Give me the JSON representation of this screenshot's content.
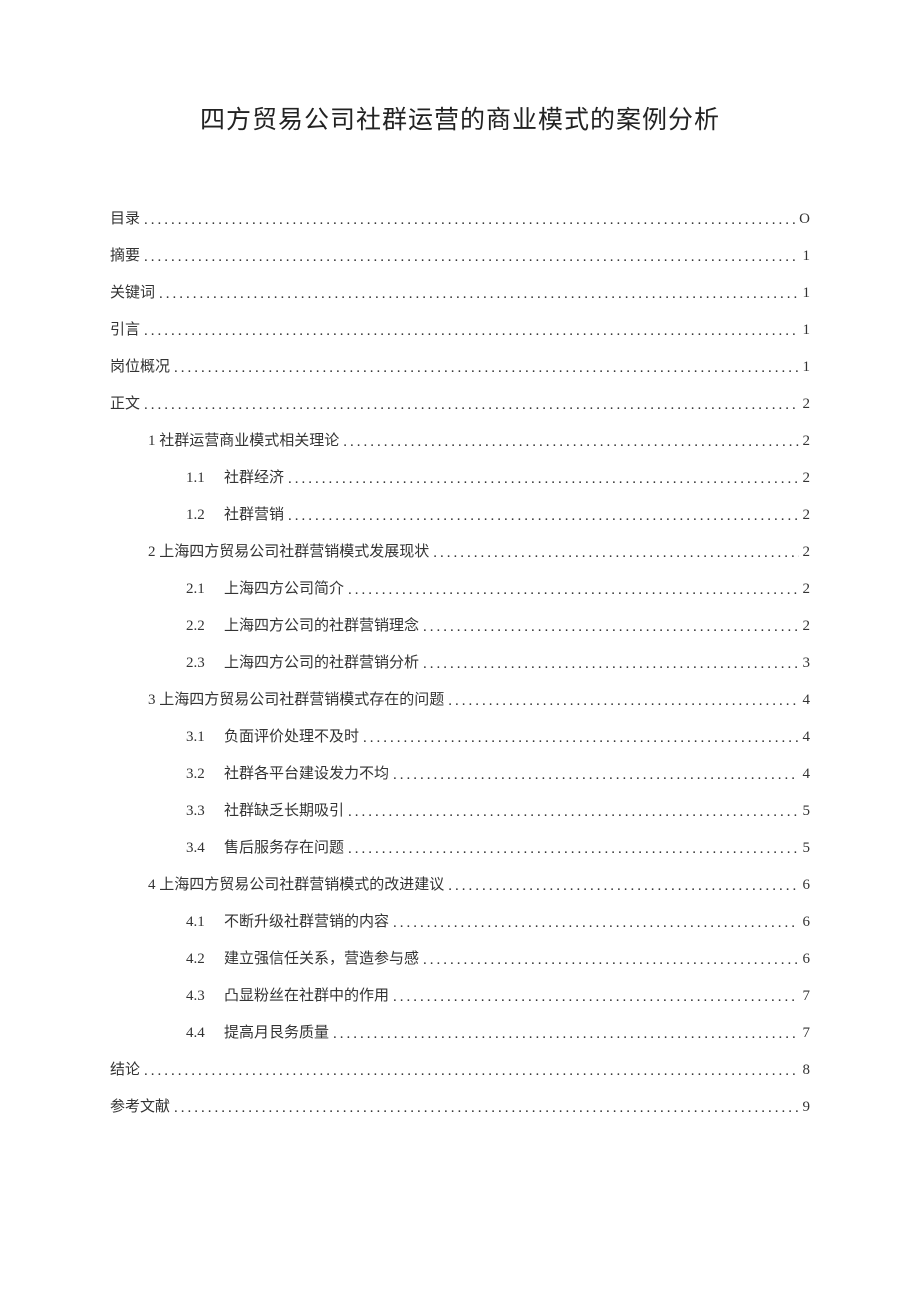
{
  "title": "四方贸易公司社群运营的商业模式的案例分析",
  "toc": [
    {
      "level": 0,
      "num": "",
      "label": "目录",
      "page": "O"
    },
    {
      "level": 0,
      "num": "",
      "label": "摘要",
      "page": "1"
    },
    {
      "level": 0,
      "num": "",
      "label": "关键词",
      "page": "1"
    },
    {
      "level": 0,
      "num": "",
      "label": "引言",
      "page": "1"
    },
    {
      "level": 0,
      "num": "",
      "label": "岗位概况",
      "page": "1"
    },
    {
      "level": 0,
      "num": "",
      "label": "正文",
      "page": "2"
    },
    {
      "level": 1,
      "num": "",
      "label": "1 社群运营商业模式相关理论",
      "page": "2"
    },
    {
      "level": 2,
      "num": "1.1",
      "label": "社群经济",
      "page": "2"
    },
    {
      "level": 2,
      "num": "1.2",
      "label": "社群营销",
      "page": "2"
    },
    {
      "level": 1,
      "num": "",
      "label": "2 上海四方贸易公司社群营销模式发展现状",
      "page": "2"
    },
    {
      "level": 2,
      "num": "2.1",
      "label": "上海四方公司简介",
      "page": "2"
    },
    {
      "level": 2,
      "num": "2.2",
      "label": "上海四方公司的社群营销理念",
      "page": "2"
    },
    {
      "level": 2,
      "num": "2.3",
      "label": "上海四方公司的社群营销分析",
      "page": "3"
    },
    {
      "level": 1,
      "num": "",
      "label": "3 上海四方贸易公司社群营销模式存在的问题",
      "page": "4"
    },
    {
      "level": 2,
      "num": "3.1",
      "label": "负面评价处理不及时",
      "page": "4"
    },
    {
      "level": 2,
      "num": "3.2",
      "label": "社群各平台建设发力不均",
      "page": "4"
    },
    {
      "level": 2,
      "num": "3.3",
      "label": "社群缺乏长期吸引",
      "page": "5"
    },
    {
      "level": 2,
      "num": "3.4",
      "label": "售后服务存在问题",
      "page": "5"
    },
    {
      "level": 1,
      "num": "",
      "label": "4 上海四方贸易公司社群营销模式的改进建议",
      "page": "6"
    },
    {
      "level": 2,
      "num": "4.1",
      "label": "不断升级社群营销的内容",
      "page": "6"
    },
    {
      "level": 2,
      "num": "4.2",
      "label": "建立强信任关系，营造参与感",
      "page": "6"
    },
    {
      "level": 2,
      "num": "4.3",
      "label": "凸显粉丝在社群中的作用",
      "page": "7"
    },
    {
      "level": 2,
      "num": "4.4",
      "label": "提高月艮务质量",
      "page": "7"
    },
    {
      "level": 0,
      "num": "",
      "label": "结论",
      "page": "8"
    },
    {
      "level": 0,
      "num": "",
      "label": "参考文献",
      "page": "9"
    }
  ]
}
